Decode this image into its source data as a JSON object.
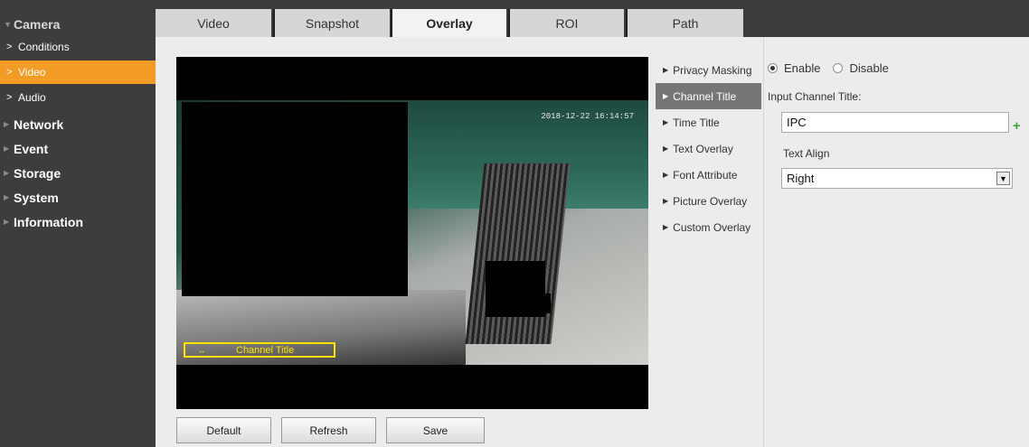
{
  "sidebar": {
    "camera": "Camera",
    "sub_items": [
      "Conditions",
      "Video",
      "Audio"
    ],
    "sections": [
      "Network",
      "Event",
      "Storage",
      "System",
      "Information"
    ]
  },
  "tabs": [
    "Video",
    "Snapshot",
    "Overlay",
    "ROI",
    "Path"
  ],
  "active_tab": "Overlay",
  "viewer": {
    "timestamp": "2018-12-22 16:14:57",
    "channel_title_osd": "Channel Title"
  },
  "buttons": {
    "default": "Default",
    "refresh": "Refresh",
    "save": "Save"
  },
  "submenu": [
    "Privacy Masking",
    "Channel Title",
    "Time Title",
    "Text Overlay",
    "Font Attribute",
    "Picture Overlay",
    "Custom Overlay"
  ],
  "active_submenu": "Channel Title",
  "form": {
    "enable": "Enable",
    "disable": "Disable",
    "input_label": "Input Channel Title:",
    "input_value": "IPC",
    "align_label": "Text Align",
    "align_value": "Right"
  },
  "colors": {
    "accent": "#f39c25",
    "sidebar": "#3d3d3d",
    "osd": "#ffe300",
    "add": "#39a93c"
  }
}
